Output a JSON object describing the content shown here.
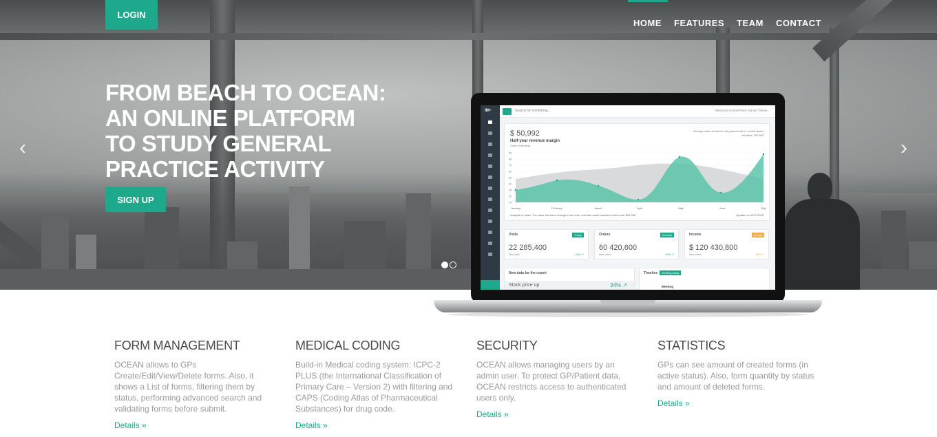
{
  "header": {
    "login_label": "LOGIN",
    "nav": [
      "HOME",
      "FEATURES",
      "TEAM",
      "CONTACT"
    ],
    "active_nav": "HOME"
  },
  "hero": {
    "headline": [
      "FROM BEACH TO OCEAN:",
      "AN ONLINE PLATFORM",
      "TO STUDY GENERAL",
      "PRACTICE ACTIVITY"
    ],
    "signup_label": "SIGN UP",
    "prev_arrow": "‹",
    "next_arrow": "›",
    "slides": 2,
    "active_slide": 1
  },
  "dashboard": {
    "logo": "IN+",
    "search_placeholder": "Search for something...",
    "welcome": "Welcome to INSPINIA+ Admin Theme.",
    "main_value": "$ 50,992",
    "main_title": "Half-year revenue margin",
    "main_subtitle": "Sales marketing.",
    "right_line1": "Average value of sales in the past month in: United states",
    "right_line2": "All sales: 162,862",
    "footer_text": "Analysis of sales: The value has been changed over time, and last month reached a level over $50,000.",
    "update_text": "Update on 16.07.2015",
    "chart_months": [
      "January",
      "February",
      "March",
      "April",
      "May",
      "June",
      "July"
    ],
    "chart_yticks": [
      "90",
      "80",
      "70",
      "60",
      "50",
      "40",
      "30",
      "20",
      "10"
    ],
    "stats": [
      {
        "title": "Visits",
        "badge": "Today",
        "value": "22 285,400",
        "sub": "New visits",
        "pct": "20% ↗",
        "warn": false
      },
      {
        "title": "Orders",
        "badge": "Monthly",
        "value": "60 420,600",
        "sub": "New orders",
        "pct": "40% ↗",
        "warn": false
      },
      {
        "title": "Income",
        "badge": "Annual",
        "value": "$ 120 430,800",
        "sub": "New orders",
        "pct": "16% ↗",
        "warn": true
      }
    ],
    "report_title": "New data for the report",
    "report_row": "Stock price up",
    "report_pct": "34% ↗",
    "timeline_title": "Timeline",
    "timeline_badge": "Meeting today",
    "timeline_item": "Meeting",
    "accent": "#1fa98c"
  },
  "features": [
    {
      "title": "FORM MANAGEMENT",
      "text": "OCEAN allows to GPs Create/Edit/View/Delete forms. Also, it shows a List of forms, filtering them by status, performing advanced search and validating forms before submit.",
      "link": "Details »"
    },
    {
      "title": "MEDICAL CODING",
      "text": "Build-in Medical coding system: ICPC-2 PLUS (the International Classification of Primary Care – Version 2) with filtering and CAPS (Coding Atlas of Pharmaceutical Substances) for drug code.",
      "link": "Details »"
    },
    {
      "title": "SECURITY",
      "text": "OCEAN allows managing users by an admin user. To protect GP/Patient data, OCEAN restricts access to authenticated users only.",
      "link": "Details »"
    },
    {
      "title": "STATISTICS",
      "text": "GPs can see amount of created forms (in active status). Also, form quantity by status and amount of deleted forms.",
      "link": "Details »"
    }
  ]
}
